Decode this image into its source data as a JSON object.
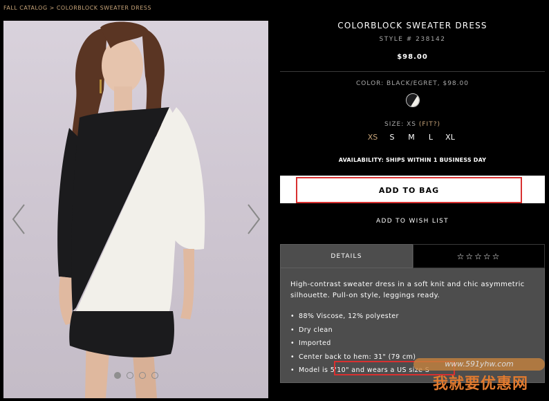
{
  "breadcrumb": {
    "parent": "FALL CATALOG",
    "separator": ">",
    "current": "COLORBLOCK SWEATER DRESS"
  },
  "product": {
    "title": "COLORBLOCK SWEATER DRESS",
    "style": "STYLE # 238142",
    "price": "$98.00",
    "color_label": "COLOR: BLACK/EGRET, $98.00",
    "size_prefix": "SIZE: XS ",
    "fit_label": "(FIT?)",
    "sizes": [
      "XS",
      "S",
      "M",
      "L",
      "XL"
    ],
    "selected_size": "XS",
    "availability": "AVAILABILITY: SHIPS WITHIN 1 BUSINESS DAY"
  },
  "actions": {
    "add_to_bag": "ADD TO BAG",
    "add_to_wish_list": "ADD TO WISH LIST"
  },
  "tabs": {
    "details": "DETAILS",
    "reviews_stars": "☆☆☆☆☆"
  },
  "details": {
    "description": "High-contrast sweater dress in a soft knit and chic asymmetric silhouette. Pull-on style, leggings ready.",
    "bullets": [
      "88% Viscose, 12% polyester",
      "Dry clean",
      "Imported",
      "Center back to hem: 31\" (79 cm)",
      "Model is 5'10\" and wears a US size S"
    ]
  },
  "gallery": {
    "image_count": 4,
    "active_index": 0
  },
  "watermark": {
    "url": "www.591yhw.com",
    "name": "我就要优惠网"
  },
  "colors": {
    "accent": "#c8a57a",
    "highlight": "#d83030",
    "panel": "#4d4d4d"
  }
}
